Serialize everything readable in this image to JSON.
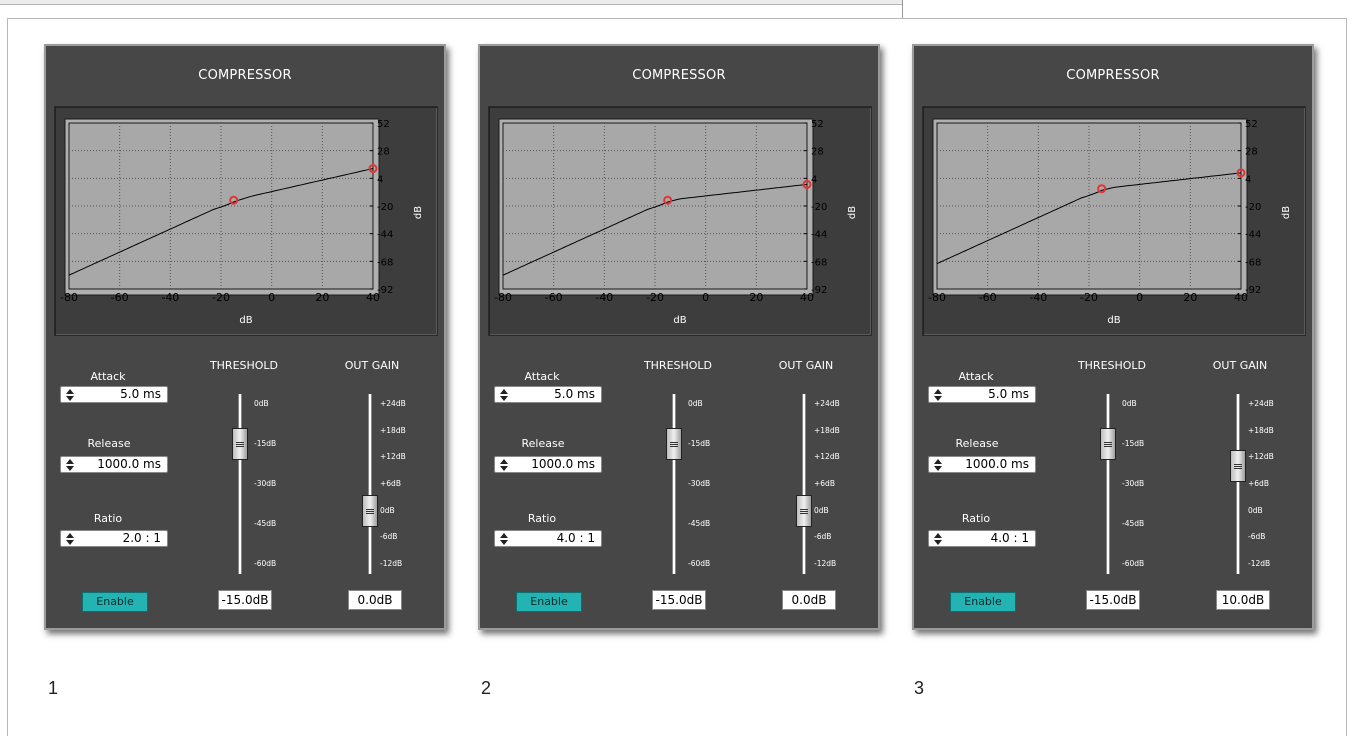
{
  "panels": [
    {
      "index": 0,
      "title": "COMPRESSOR",
      "caption": "1",
      "attack": {
        "label": "Attack",
        "value": "5.0 ms"
      },
      "release": {
        "label": "Release",
        "value": "1000.0 ms"
      },
      "ratio": {
        "label": "Ratio",
        "value": "2.0 : 1",
        "numeric": 2.0
      },
      "threshold": {
        "label": "THRESHOLD",
        "value": "-15.0dB",
        "db": -15
      },
      "out_gain": {
        "label": "OUT GAIN",
        "value": "0.0dB",
        "db": 0
      },
      "enable_label": "Enable",
      "graph_xlabel": "dB",
      "graph_ylabel": "dB"
    },
    {
      "index": 1,
      "title": "COMPRESSOR",
      "caption": "2",
      "attack": {
        "label": "Attack",
        "value": "5.0 ms"
      },
      "release": {
        "label": "Release",
        "value": "1000.0 ms"
      },
      "ratio": {
        "label": "Ratio",
        "value": "4.0 : 1",
        "numeric": 4.0
      },
      "threshold": {
        "label": "THRESHOLD",
        "value": "-15.0dB",
        "db": -15
      },
      "out_gain": {
        "label": "OUT GAIN",
        "value": "0.0dB",
        "db": 0
      },
      "enable_label": "Enable",
      "graph_xlabel": "dB",
      "graph_ylabel": "dB"
    },
    {
      "index": 2,
      "title": "COMPRESSOR",
      "caption": "3",
      "attack": {
        "label": "Attack",
        "value": "5.0 ms"
      },
      "release": {
        "label": "Release",
        "value": "1000.0 ms"
      },
      "ratio": {
        "label": "Ratio",
        "value": "4.0 : 1",
        "numeric": 4.0
      },
      "threshold": {
        "label": "THRESHOLD",
        "value": "-15.0dB",
        "db": -15
      },
      "out_gain": {
        "label": "OUT GAIN",
        "value": "10.0dB",
        "db": 10
      },
      "enable_label": "Enable",
      "graph_xlabel": "dB",
      "graph_ylabel": "dB"
    }
  ],
  "graph": {
    "x_ticks": [
      "-80",
      "-60",
      "-40",
      "-20",
      "0",
      "20",
      "40"
    ],
    "y_ticks": [
      "52",
      "28",
      "4",
      "-20",
      "-44",
      "-68",
      "-92"
    ],
    "x_range": [
      -80,
      40
    ],
    "y_range": [
      -92,
      52
    ]
  },
  "threshold_scale": [
    "0dB",
    "-15dB",
    "-30dB",
    "-45dB",
    "-60dB"
  ],
  "out_gain_scale": [
    "+24dB",
    "+18dB",
    "+12dB",
    "+6dB",
    "0dB",
    "-6dB",
    "-12dB"
  ],
  "colors": {
    "panel_bg": "#474747",
    "graph_bg": "#a8a8a8",
    "enable_button": "#23b3b2",
    "point_marker": "#e53333"
  },
  "icons": {
    "spin_arrows": "up-down-arrows-icon"
  }
}
